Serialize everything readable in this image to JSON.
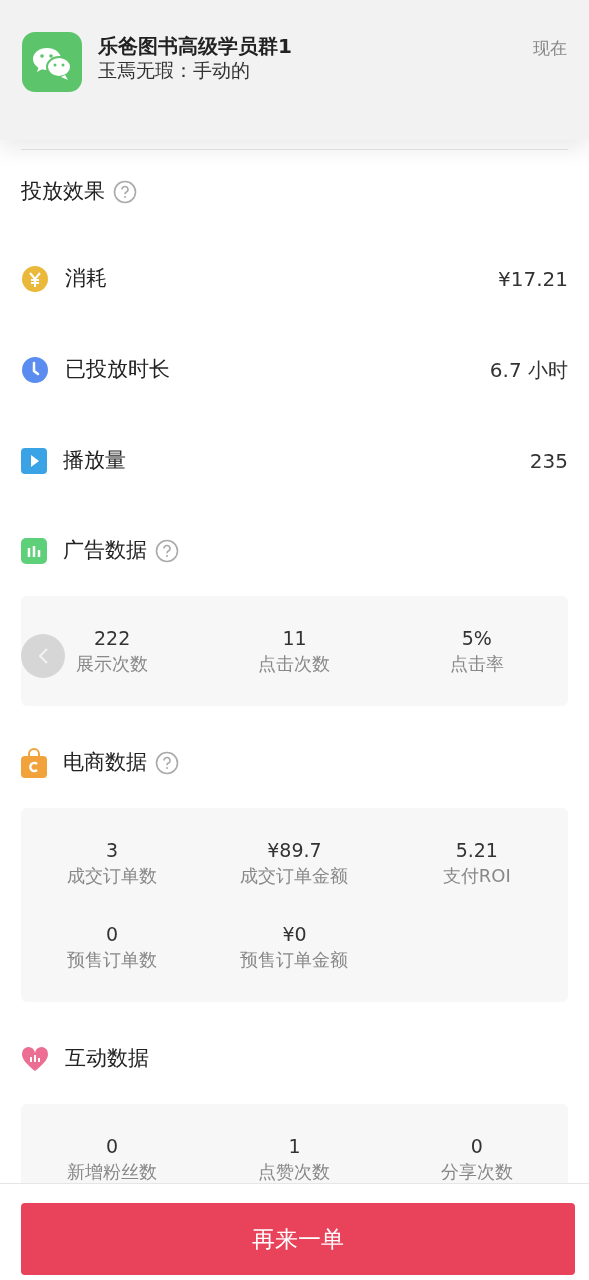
{
  "notification": {
    "title": "乐爸图书高级学员群1",
    "message": "玉焉无瑕：手动的",
    "time": "现在"
  },
  "summary": {
    "title": "投放效果",
    "help": true,
    "rows": [
      {
        "kind": "spend",
        "label": "消耗",
        "value": "¥17.21"
      },
      {
        "kind": "duration",
        "label": "已投放时长",
        "value": "6.7 小时"
      },
      {
        "kind": "plays",
        "label": "播放量",
        "value": "235"
      }
    ]
  },
  "sections": [
    {
      "kind": "ads",
      "title": "广告数据",
      "help": true,
      "prev_button": true,
      "metrics": [
        {
          "value": "222",
          "label": "展示次数"
        },
        {
          "value": "11",
          "label": "点击次数"
        },
        {
          "value": "5%",
          "label": "点击率"
        }
      ]
    },
    {
      "kind": "shop",
      "title": "电商数据",
      "help": true,
      "prev_button": false,
      "metrics": [
        {
          "value": "3",
          "label": "成交订单数"
        },
        {
          "value": "¥89.7",
          "label": "成交订单金额"
        },
        {
          "value": "5.21",
          "label": "支付ROI"
        },
        {
          "value": "0",
          "label": "预售订单数"
        },
        {
          "value": "¥0",
          "label": "预售订单金额"
        }
      ]
    },
    {
      "kind": "interaction",
      "title": "互动数据",
      "help": false,
      "prev_button": false,
      "metrics": [
        {
          "value": "0",
          "label": "新增粉丝数"
        },
        {
          "value": "1",
          "label": "点赞次数"
        },
        {
          "value": "0",
          "label": "分享次数"
        }
      ]
    }
  ],
  "action_button": "再来一单"
}
